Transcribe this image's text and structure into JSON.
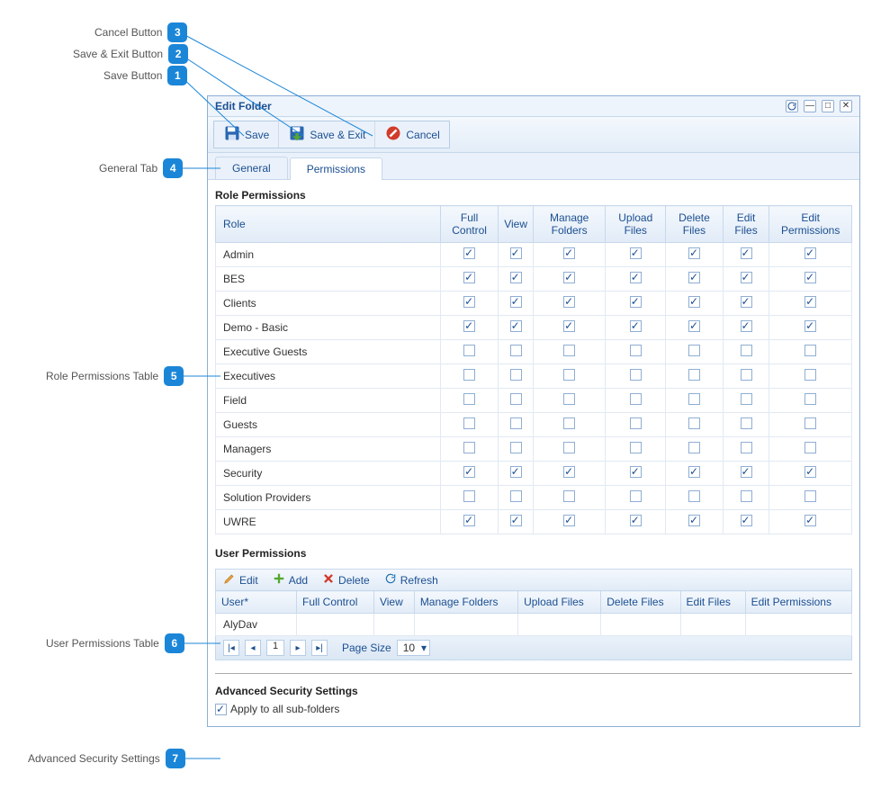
{
  "callouts": {
    "c1": {
      "label": "Save Button",
      "num": "1"
    },
    "c2": {
      "label": "Save & Exit Button",
      "num": "2"
    },
    "c3": {
      "label": "Cancel Button",
      "num": "3"
    },
    "c4": {
      "label": "General Tab",
      "num": "4"
    },
    "c5": {
      "label": "Role Permissions Table",
      "num": "5"
    },
    "c6": {
      "label": "User Permissions Table",
      "num": "6"
    },
    "c7": {
      "label": "Advanced Security Settings",
      "num": "7"
    }
  },
  "window": {
    "title": "Edit Folder"
  },
  "toolbar": {
    "save": "Save",
    "save_exit": "Save & Exit",
    "cancel": "Cancel"
  },
  "tabs": {
    "general": "General",
    "permissions": "Permissions"
  },
  "role_section_title": "Role Permissions",
  "role_table": {
    "headers": {
      "role": "Role",
      "full_control": "Full Control",
      "view": "View",
      "manage_folders": "Manage Folders",
      "upload_files": "Upload Files",
      "delete_files": "Delete Files",
      "edit_files": "Edit Files",
      "edit_permissions": "Edit Permissions"
    },
    "rows": [
      {
        "role": "Admin",
        "v": [
          true,
          true,
          true,
          true,
          true,
          true,
          true
        ]
      },
      {
        "role": "BES",
        "v": [
          true,
          true,
          true,
          true,
          true,
          true,
          true
        ]
      },
      {
        "role": "Clients",
        "v": [
          true,
          true,
          true,
          true,
          true,
          true,
          true
        ]
      },
      {
        "role": "Demo - Basic",
        "v": [
          true,
          true,
          true,
          true,
          true,
          true,
          true
        ]
      },
      {
        "role": "Executive Guests",
        "v": [
          false,
          false,
          false,
          false,
          false,
          false,
          false
        ]
      },
      {
        "role": "Executives",
        "v": [
          false,
          false,
          false,
          false,
          false,
          false,
          false
        ]
      },
      {
        "role": "Field",
        "v": [
          false,
          false,
          false,
          false,
          false,
          false,
          false
        ]
      },
      {
        "role": "Guests",
        "v": [
          false,
          false,
          false,
          false,
          false,
          false,
          false
        ]
      },
      {
        "role": "Managers",
        "v": [
          false,
          false,
          false,
          false,
          false,
          false,
          false
        ]
      },
      {
        "role": "Security",
        "v": [
          true,
          true,
          true,
          true,
          true,
          true,
          true
        ]
      },
      {
        "role": "Solution Providers",
        "v": [
          false,
          false,
          false,
          false,
          false,
          false,
          false
        ]
      },
      {
        "role": "UWRE",
        "v": [
          true,
          true,
          true,
          true,
          true,
          true,
          true
        ]
      }
    ]
  },
  "user_section_title": "User Permissions",
  "user_toolbar": {
    "edit": "Edit",
    "add": "Add",
    "delete": "Delete",
    "refresh": "Refresh"
  },
  "user_table": {
    "headers": {
      "user": "User*",
      "full_control": "Full Control",
      "view": "View",
      "manage_folders": "Manage Folders",
      "upload_files": "Upload Files",
      "delete_files": "Delete Files",
      "edit_files": "Edit Files",
      "edit_permissions": "Edit Permissions"
    },
    "rows": [
      {
        "user": "AlyDav",
        "v": [
          true,
          true,
          true,
          true,
          true,
          true,
          true
        ]
      }
    ]
  },
  "pager": {
    "first": "|◂",
    "prev": "◂",
    "page": "1",
    "next": "▸",
    "last": "▸|",
    "page_size_label": "Page Size",
    "page_size_value": "10"
  },
  "advanced": {
    "title": "Advanced Security Settings",
    "apply_label": "Apply to all sub-folders",
    "apply_checked": true
  }
}
